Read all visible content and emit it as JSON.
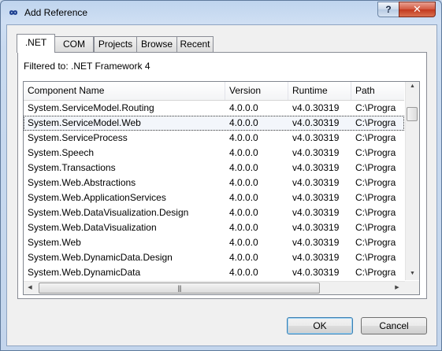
{
  "window": {
    "title": "Add Reference",
    "help_glyph": "?",
    "close_glyph": "✕"
  },
  "tabs": [
    ".NET",
    "COM",
    "Projects",
    "Browse",
    "Recent"
  ],
  "active_tab": ".NET",
  "filter_label": "Filtered to: .NET Framework 4",
  "columns": [
    "Component Name",
    "Version",
    "Runtime",
    "Path"
  ],
  "rows": [
    {
      "name": "System.ServiceModel.Routing",
      "version": "4.0.0.0",
      "runtime": "v4.0.30319",
      "path": "C:\\Progra"
    },
    {
      "name": "System.ServiceModel.Web",
      "version": "4.0.0.0",
      "runtime": "v4.0.30319",
      "path": "C:\\Progra"
    },
    {
      "name": "System.ServiceProcess",
      "version": "4.0.0.0",
      "runtime": "v4.0.30319",
      "path": "C:\\Progra"
    },
    {
      "name": "System.Speech",
      "version": "4.0.0.0",
      "runtime": "v4.0.30319",
      "path": "C:\\Progra"
    },
    {
      "name": "System.Transactions",
      "version": "4.0.0.0",
      "runtime": "v4.0.30319",
      "path": "C:\\Progra"
    },
    {
      "name": "System.Web.Abstractions",
      "version": "4.0.0.0",
      "runtime": "v4.0.30319",
      "path": "C:\\Progra"
    },
    {
      "name": "System.Web.ApplicationServices",
      "version": "4.0.0.0",
      "runtime": "v4.0.30319",
      "path": "C:\\Progra"
    },
    {
      "name": "System.Web.DataVisualization.Design",
      "version": "4.0.0.0",
      "runtime": "v4.0.30319",
      "path": "C:\\Progra"
    },
    {
      "name": "System.Web.DataVisualization",
      "version": "4.0.0.0",
      "runtime": "v4.0.30319",
      "path": "C:\\Progra"
    },
    {
      "name": "System.Web",
      "version": "4.0.0.0",
      "runtime": "v4.0.30319",
      "path": "C:\\Progra"
    },
    {
      "name": "System.Web.DynamicData.Design",
      "version": "4.0.0.0",
      "runtime": "v4.0.30319",
      "path": "C:\\Progra"
    },
    {
      "name": "System.Web.DynamicData",
      "version": "4.0.0.0",
      "runtime": "v4.0.30319",
      "path": "C:\\Progra"
    }
  ],
  "selected_row": "System.ServiceModel.Web",
  "buttons": {
    "ok": "OK",
    "cancel": "Cancel"
  },
  "scroll_glyphs": {
    "up": "▲",
    "down": "▼",
    "left": "◀",
    "right": "▶",
    "grip": "|||"
  },
  "icons": {
    "app": "infinity-app-icon"
  },
  "colors": {
    "title_bg": "#c9daef",
    "close_red": "#c2391e",
    "default_button_border": "#3c7fb1"
  }
}
